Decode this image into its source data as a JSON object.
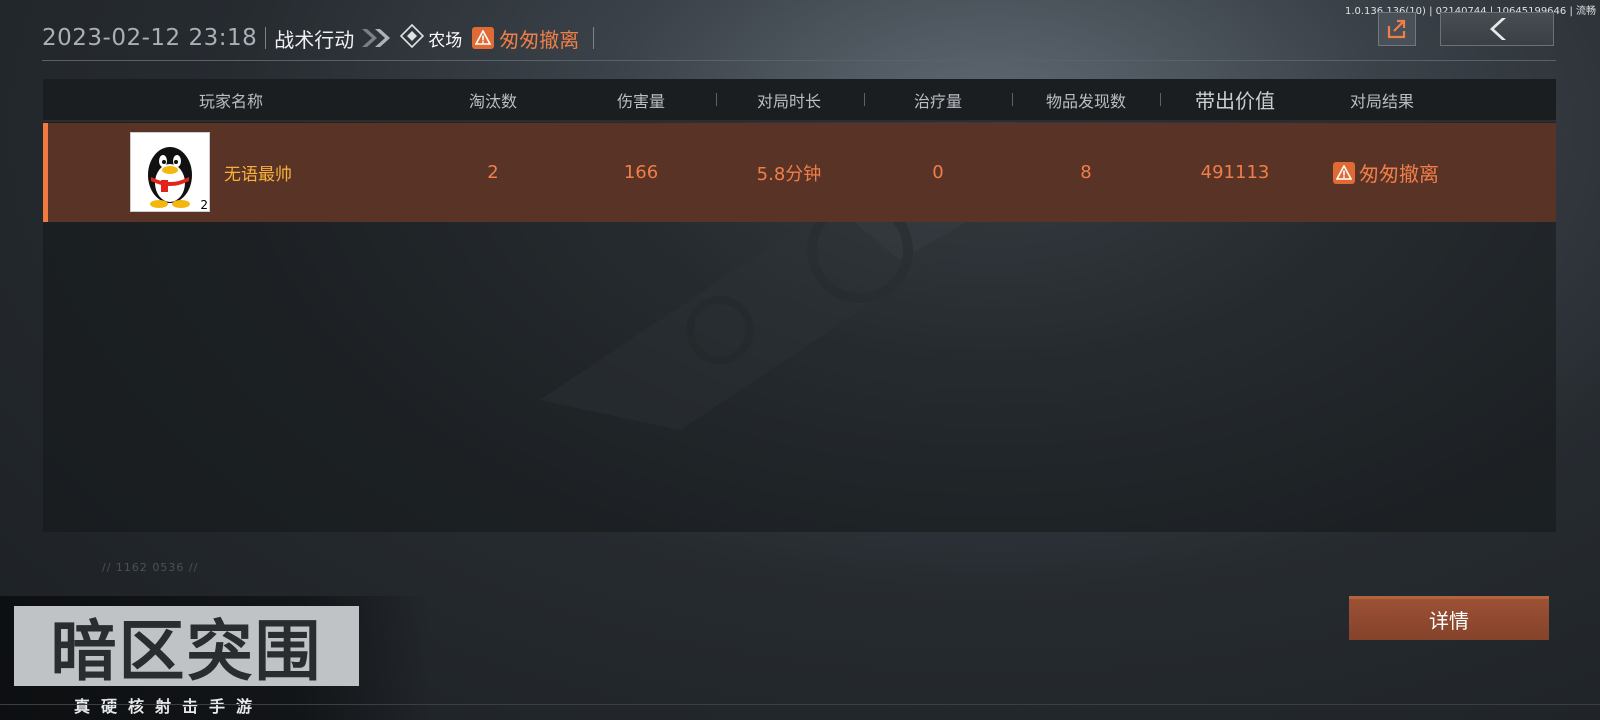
{
  "build_info": "1.0.136.136(10) | 02140744 | 10645199646 | 流畅",
  "header": {
    "datetime": "2023-02-12 23:18",
    "mode": "战术行动",
    "map": "农场",
    "result": "匆匆撤离"
  },
  "icons": {
    "share": "share-icon",
    "back": "back-arrow-icon",
    "warning": "warning-icon",
    "map": "diamond-map-icon"
  },
  "table": {
    "columns": [
      "玩家名称",
      "淘汰数",
      "伤害量",
      "对局时长",
      "治疗量",
      "物品发现数",
      "带出价值",
      "对局结果"
    ],
    "rows": [
      {
        "player_name": "无语最帅",
        "avatar_level": "2",
        "eliminations": "2",
        "damage": "166",
        "duration": "5.8分钟",
        "healing": "0",
        "items_found": "8",
        "extracted_value": "491113",
        "result": "匆匆撤离"
      }
    ]
  },
  "faint_code": "// 1162 0536 //",
  "detail_button": "详情",
  "logo": {
    "title": "暗区突围",
    "subtitle": "真硬核射击手游"
  },
  "colors": {
    "accent_orange": "#f07e48",
    "row_bg": "#5a3327",
    "player_name": "#f6b13a"
  }
}
